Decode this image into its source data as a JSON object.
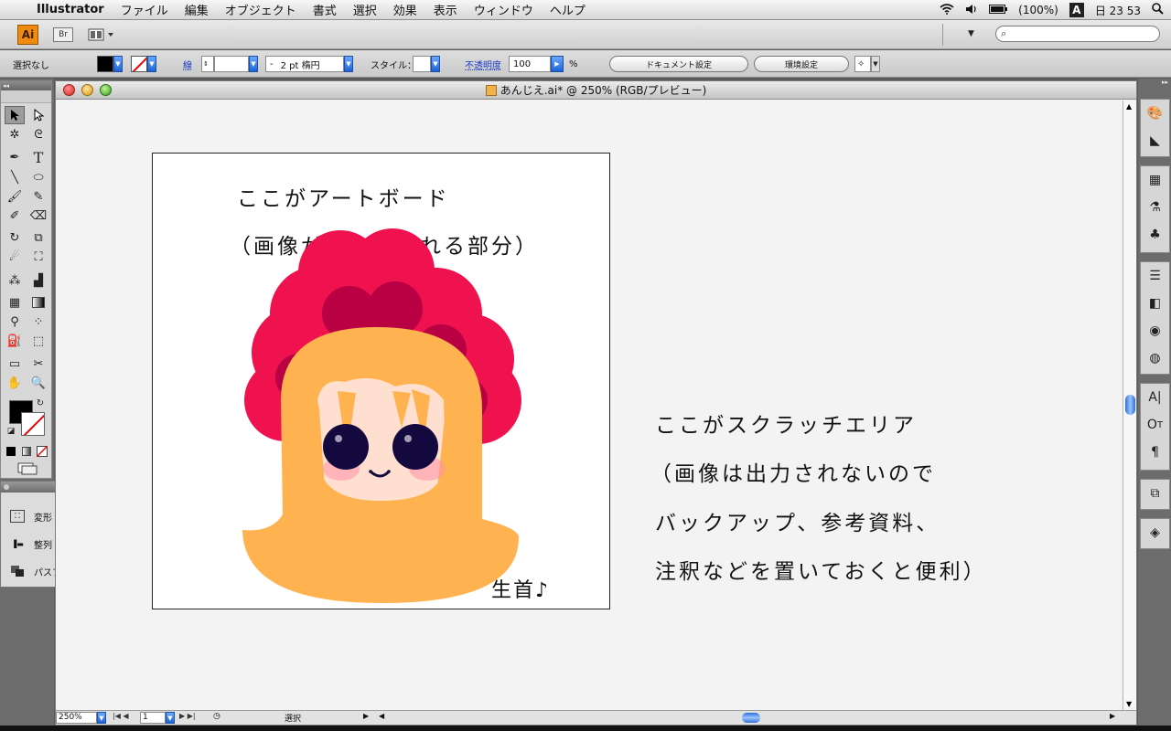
{
  "menubar": {
    "app_name": "Illustrator",
    "menus": [
      "ファイル",
      "編集",
      "オブジェクト",
      "書式",
      "選択",
      "効果",
      "表示",
      "ウィンドウ",
      "ヘルプ"
    ],
    "battery": "(100%)",
    "input_method": "A",
    "clock": "日 23 53"
  },
  "appbar": {
    "app_badge": "Ai",
    "bridge_badge": "Br"
  },
  "control": {
    "selection_label": "選択なし",
    "stroke_label": "線",
    "brush_value": "2 pt 楕円",
    "style_label": "スタイル：",
    "opacity_label": "不透明度",
    "opacity_value": "100",
    "percent": "%",
    "document_setup": "ドキュメント設定",
    "preferences": "環境設定",
    "fill_color": "#000000",
    "stroke_color": "none"
  },
  "panels": {
    "float": [
      {
        "icon": "transform-icon",
        "label": "変形"
      },
      {
        "icon": "align-icon",
        "label": "整列"
      },
      {
        "icon": "pathfinder-icon",
        "label": "パスファインダ"
      }
    ]
  },
  "document": {
    "title": "あんじえ.ai* @ 250% (RGB/プレビュー)",
    "artboard_text_1": "ここがアートボード",
    "artboard_text_2": "（画像が書き出される部分）",
    "signature": "生首♪",
    "scratch_text_1": "ここがスクラッチエリア",
    "scratch_text_2": "（画像は出力されないので",
    "scratch_text_3": "バックアップ、参考資料、",
    "scratch_text_4": "注釈などを置いておくと便利）"
  },
  "statusbar": {
    "zoom": "250%",
    "page": "1",
    "status": "選択"
  },
  "colors": {
    "hair": "#ffb350",
    "flower_outer": "#f0114f",
    "flower_inner": "#b90042",
    "face": "#ffe0d0",
    "eye": "#13093e",
    "blush": "#ff8fa8"
  }
}
